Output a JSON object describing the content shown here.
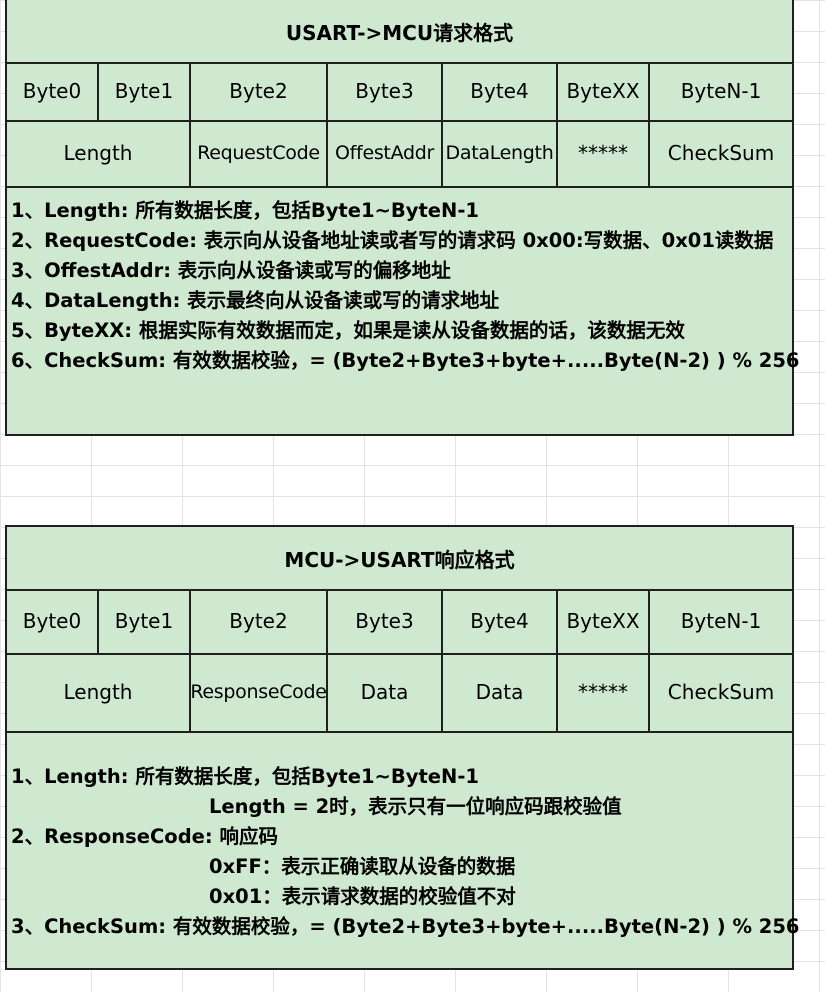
{
  "request": {
    "title": "USART->MCU请求格式",
    "bytes": [
      "Byte0",
      "Byte1",
      "Byte2",
      "Byte3",
      "Byte4",
      "ByteXX",
      "ByteN-1"
    ],
    "fields": [
      "Length",
      "RequestCode",
      "OffestAddr",
      "DataLength",
      "*****",
      "CheckSum"
    ],
    "notes": [
      "1、Length: 所有数据长度，包括Byte1~ByteN-1",
      "2、RequestCode: 表示向从设备地址读或者写的请求码 0x00:写数据、0x01读数据",
      "3、OffestAddr: 表示向从设备读或写的偏移地址",
      "4、DataLength: 表示最终向从设备读或写的请求地址",
      "5、ByteXX: 根据实际有效数据而定，如果是读从设备数据的话，该数据无效",
      "6、CheckSum: 有效数据校验，= (Byte2+Byte3+byte+.....Byte(N-2) ) % 256"
    ]
  },
  "response": {
    "title": "MCU->USART响应格式",
    "bytes": [
      "Byte0",
      "Byte1",
      "Byte2",
      "Byte3",
      "Byte4",
      "ByteXX",
      "ByteN-1"
    ],
    "fields": [
      "Length",
      "ResponseCode",
      "Data",
      "Data",
      "*****",
      "CheckSum"
    ],
    "notes": [
      "1、Length: 所有数据长度，包括Byte1~ByteN-1",
      "Length = 2时，表示只有一位响应码跟校验值",
      "2、ResponseCode: 响应码",
      "0xFF：表示正确读取从设备的数据",
      "0x01：表示请求数据的校验值不对",
      "3、CheckSum: 有效数据校验，= (Byte2+Byte3+byte+.....Byte(N-2) ) % 256"
    ]
  }
}
